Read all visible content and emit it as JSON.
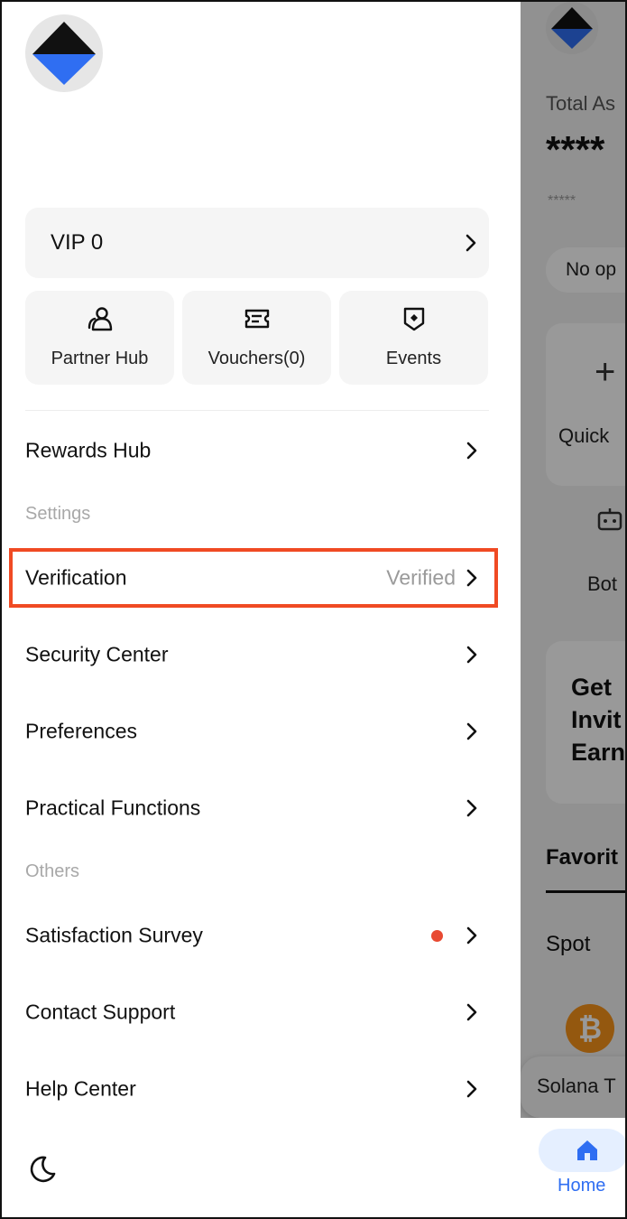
{
  "drawer": {
    "vip_label": "VIP 0",
    "quick_actions": [
      {
        "label": "Partner Hub",
        "icon": "partner-icon"
      },
      {
        "label": "Vouchers(0)",
        "icon": "voucher-icon"
      },
      {
        "label": "Events",
        "icon": "events-icon"
      }
    ],
    "rewards_hub": "Rewards Hub",
    "settings_header": "Settings",
    "settings": [
      {
        "label": "Verification",
        "status": "Verified"
      },
      {
        "label": "Security Center"
      },
      {
        "label": "Preferences"
      },
      {
        "label": "Practical Functions"
      }
    ],
    "others_header": "Others",
    "others": [
      {
        "label": "Satisfaction Survey",
        "has_dot": true
      },
      {
        "label": "Contact Support"
      },
      {
        "label": "Help Center"
      }
    ],
    "theme_icon": "moon-icon"
  },
  "background": {
    "total_assets_label": "Total As",
    "masked_balance": "****",
    "masked_small": "*****",
    "pill_text": "No op",
    "quick_text": "Quick",
    "bot_text": "Bot",
    "banner_lines": [
      "Get",
      "Invit",
      "Earn"
    ],
    "favorites_tab": "Favorit",
    "spot_label": "Spot",
    "coin_symbol": "₿",
    "toast_text": "Solana T",
    "nav_home_label": "Home"
  },
  "colors": {
    "accent_blue": "#2f6ef2",
    "highlight_orange": "#f04a23",
    "notification_red": "#e84a32",
    "bitcoin_orange": "#f7931a"
  }
}
